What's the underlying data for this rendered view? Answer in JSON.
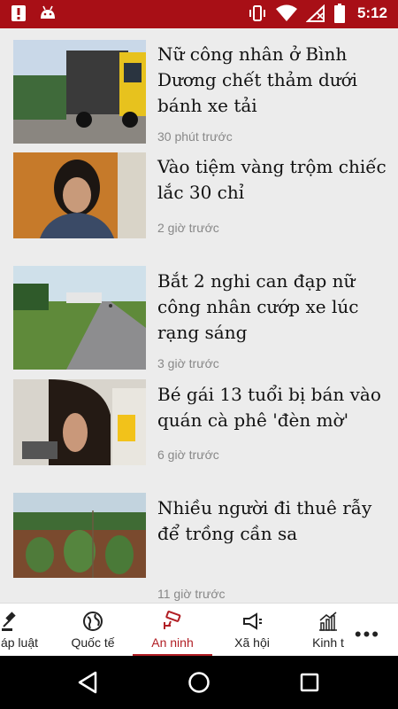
{
  "status_bar": {
    "time": "5:12",
    "left_icons": [
      "alert-icon",
      "android-icon"
    ],
    "right_icons": [
      "vibrate-icon",
      "wifi-icon",
      "signal-off-icon",
      "battery-icon"
    ],
    "background_color": "#a80f16"
  },
  "articles": [
    {
      "headline": "Nữ công nhân ở Bình Dương chết thảm dưới bánh xe tải",
      "time": "30 phút trước",
      "thumbnail": "truck-photo"
    },
    {
      "headline": "Vào tiệm vàng trộm chiếc lắc 30 chỉ",
      "time": "2 giờ trước",
      "thumbnail": "woman-photo"
    },
    {
      "headline": "Bắt 2 nghi can đạp nữ công nhân cướp xe lúc rạng sáng",
      "time": "3 giờ trước",
      "thumbnail": "road-photo"
    },
    {
      "headline": "Bé gái 13 tuổi bị bán vào quán cà phê 'đèn mờ'",
      "time": "6 giờ trước",
      "thumbnail": "girl-photo"
    },
    {
      "headline": "Nhiều người đi thuê rẫy để trồng cần sa",
      "time": "11 giờ trước",
      "thumbnail": "plants-photo"
    }
  ],
  "tabs": [
    {
      "label": "áp luật",
      "icon": "gavel-icon",
      "active": false
    },
    {
      "label": "Quốc tế",
      "icon": "globe-icon",
      "active": false
    },
    {
      "label": "An ninh",
      "icon": "cctv-icon",
      "active": true
    },
    {
      "label": "Xã hội",
      "icon": "megaphone-icon",
      "active": false
    },
    {
      "label": "Kinh t",
      "icon": "chart-icon",
      "active": false
    }
  ],
  "more_label": "•••",
  "accent_color": "#b11e24"
}
